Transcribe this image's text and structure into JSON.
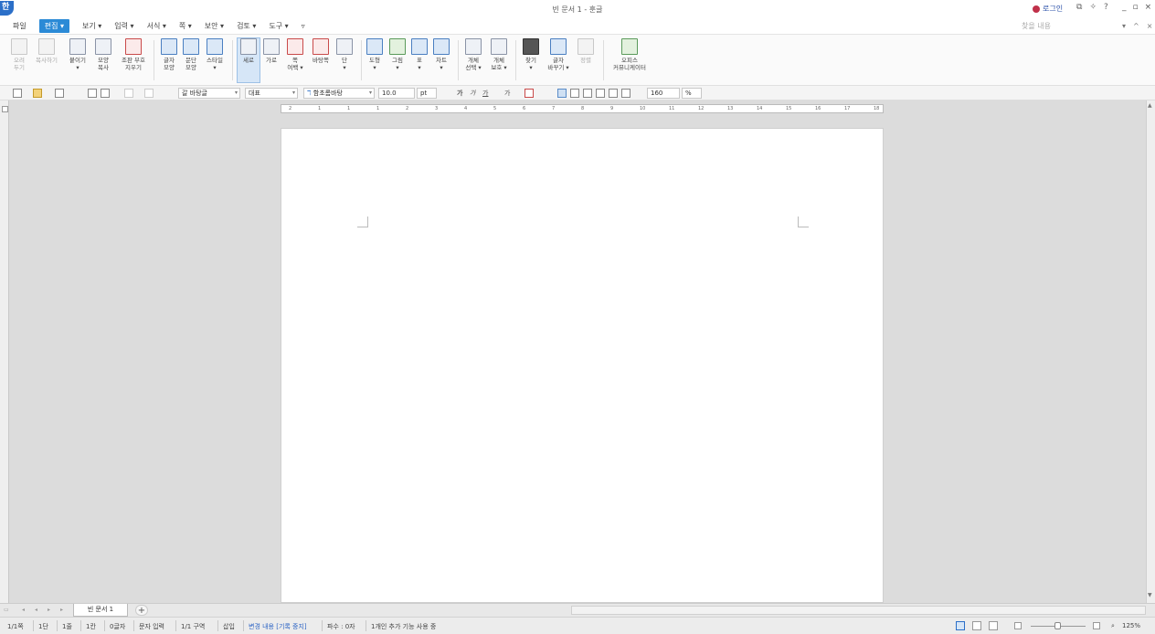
{
  "title_bar": {
    "app_logo": "한",
    "window_title": "빈 문서 1 - 훈글",
    "login_label": "로그인",
    "help_icons": [
      "restore-icon",
      "arrow-icon",
      "help-icon"
    ],
    "help_label": "?",
    "controls": [
      "_",
      "▫",
      "×"
    ]
  },
  "menu": {
    "items": [
      "파일",
      "편집 ▾",
      "보기 ▾",
      "입력 ▾",
      "서식 ▾",
      "쪽 ▾",
      "보안 ▾",
      "검토 ▾",
      "도구 ▾",
      "▿"
    ],
    "active_index": 1,
    "help_search": "찾을 내용",
    "right_controls": [
      "▾",
      "^",
      "×"
    ]
  },
  "ribbon": {
    "buttons": [
      {
        "label": "오려\n두기",
        "icon": "scissors-icon",
        "disabled": true
      },
      {
        "label": "복사하기",
        "icon": "copy-icon",
        "disabled": true
      },
      {
        "label": "붙이기\n▾",
        "icon": "paste-icon"
      },
      {
        "label": "모양\n복사",
        "icon": "format-copy-icon"
      },
      {
        "label": "조판 부호\n지우기",
        "icon": "clear-marks-icon"
      },
      {
        "label": "글자\n모양",
        "icon": "char-shape-icon"
      },
      {
        "label": "문단\n모양",
        "icon": "para-shape-icon"
      },
      {
        "label": "스타일\n▾",
        "icon": "style-icon"
      },
      {
        "label": "세로",
        "icon": "portrait-icon",
        "selected": true
      },
      {
        "label": "가로",
        "icon": "landscape-icon"
      },
      {
        "label": "쪽\n여백 ▾",
        "icon": "margin-icon"
      },
      {
        "label": "바탕쪽",
        "icon": "master-page-icon"
      },
      {
        "label": "단\n▾",
        "icon": "columns-icon"
      },
      {
        "label": "도형\n▾",
        "icon": "shape-icon"
      },
      {
        "label": "그림\n▾",
        "icon": "picture-icon"
      },
      {
        "label": "표\n▾",
        "icon": "table-icon"
      },
      {
        "label": "차트\n▾",
        "icon": "chart-icon"
      },
      {
        "label": "개체\n선택 ▾",
        "icon": "select-object-icon"
      },
      {
        "label": "개체\n보호 ▾",
        "icon": "protect-object-icon"
      },
      {
        "label": "찾기\n▾",
        "icon": "binoculars-icon"
      },
      {
        "label": "글자\n바꾸기 ▾",
        "icon": "replace-icon"
      },
      {
        "label": "정렬",
        "icon": "sort-icon",
        "disabled": true
      },
      {
        "label": "오피스\n커뮤니케이터",
        "icon": "communicator-icon"
      }
    ]
  },
  "format_bar": {
    "style": "갈 바탕글",
    "language": "대표",
    "font": "함초롬바탕",
    "size": "10.0",
    "size_unit": "pt",
    "char_buttons": [
      "가",
      "가",
      "가",
      "가"
    ],
    "zoom": "160",
    "zoom_unit": "%"
  },
  "ruler": {
    "ticks": [
      "2",
      "1",
      "1",
      "1",
      "2",
      "3",
      "4",
      "5",
      "6",
      "7",
      "8",
      "9",
      "10",
      "11",
      "12",
      "13",
      "14",
      "15",
      "16",
      "17",
      "18"
    ]
  },
  "tabs": {
    "doc_tab": "빈 문서 1",
    "add_tab": "+"
  },
  "status": {
    "page": "1/1쪽",
    "section": "1단",
    "line": "1줄",
    "column": "1칸",
    "chars": "0글자",
    "mode": "문자 입력",
    "division": "1/1 구역",
    "insert": "삽입",
    "track": "변경 내용 [기록 중지]",
    "revision": "파수 : 0자",
    "users": "1개인 추가 기능 사용 중",
    "zoom": "125%"
  }
}
